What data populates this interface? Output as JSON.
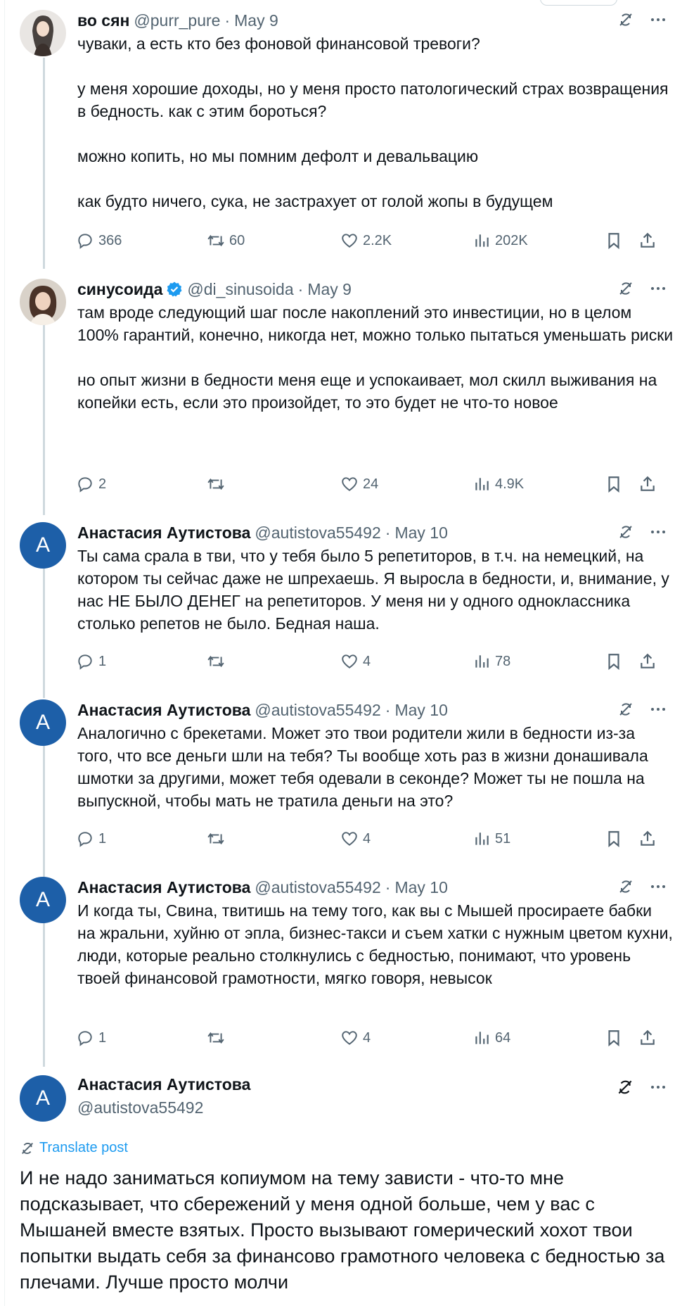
{
  "tweets": [
    {
      "name": "во сян",
      "handle": "@purr_pure",
      "date": "May 9",
      "verified": false,
      "text": "чуваки, а есть кто без фоновой финансовой тревоги?\n\nу меня хорошие доходы, но у меня просто патологический страх возвращения в бедность. как с этим бороться?\n\nможно копить, но мы помним дефолт и девальвацию\n\nкак будто ничего, сука, не застрахует от голой жопы в будущем",
      "replies": "366",
      "reposts": "60",
      "likes": "2.2K",
      "views": "202K"
    },
    {
      "name": "синусоида",
      "handle": "@di_sinusoida",
      "date": "May 9",
      "verified": true,
      "text": "там вроде следующий шаг после накоплений это инвестиции, но в целом 100% гарантий, конечно, никогда нет, можно только пытаться уменьшать риски\n\nно опыт жизни в бедности меня еще и успокаивает, мол скилл выживания на копейки есть, если это произойдет, то это будет не что-то новое",
      "replies": "2",
      "reposts": "",
      "likes": "24",
      "views": "4.9K"
    },
    {
      "name": "Анастасия Аутистова",
      "handle": "@autistova55492",
      "date": "May 10",
      "avatar_letter": "A",
      "text": "Ты сама срала в тви, что у тебя было 5 репетиторов, в т.ч. на немецкий, на котором ты сейчас даже не шпрехаешь. Я выросла в бедности, и, внимание, у нас НЕ БЫЛО ДЕНЕГ на репетиторов. У меня ни у одного одноклассника столько репетов не было. Бедная наша.",
      "replies": "1",
      "reposts": "",
      "likes": "4",
      "views": "78"
    },
    {
      "name": "Анастасия Аутистова",
      "handle": "@autistova55492",
      "date": "May 10",
      "avatar_letter": "A",
      "text": "Аналогично с брекетами. Может это твои родители жили в бедности из-за того, что все деньги шли на тебя? Ты вообще хоть раз в жизни донашивала шмотки за другими, может тебя одевали в секонде? Может ты не пошла на выпускной, чтобы мать не тратила деньги на это?",
      "replies": "1",
      "reposts": "",
      "likes": "4",
      "views": "51"
    },
    {
      "name": "Анастасия Аутистова",
      "handle": "@autistova55492",
      "date": "May 10",
      "avatar_letter": "A",
      "text": "И когда ты, Свина, твитишь на тему того, как вы с Мышей просираете бабки на жральни, хуйню от эпла, бизнес-такси и съем хатки с нужным цветом кухни, люди, которые реально столкнулись с бедностью, понимают, что уровень твоей финансовой грамотности, мягко говоря, невысок",
      "replies": "1",
      "reposts": "",
      "likes": "4",
      "views": "64"
    }
  ],
  "main": {
    "name": "Анастасия Аутистова",
    "handle": "@autistova55492",
    "avatar_letter": "A",
    "translate_label": "Translate post",
    "text": "И не надо заниматься копиумом на тему зависти - что-то мне подсказывает, что сбережений у меня одной больше, чем у вас с Мышаней вместе взятых. Просто вызывают гомерический хохот твои попытки выдать себя за финансово грамотного человека с бедностью за плечами. Лучше просто молчи"
  },
  "colors": {
    "text": "#0f1419",
    "secondary": "#536471",
    "link": "#1d9bf0",
    "avatar_bg": "#1d5fa8",
    "thread_line": "#cfd9de"
  },
  "icons": [
    "grok-icon",
    "more-icon",
    "reply-icon",
    "repost-icon",
    "like-icon",
    "views-icon",
    "bookmark-icon",
    "share-icon",
    "verified-badge-icon",
    "translate-icon"
  ],
  "separator_dot": "·"
}
